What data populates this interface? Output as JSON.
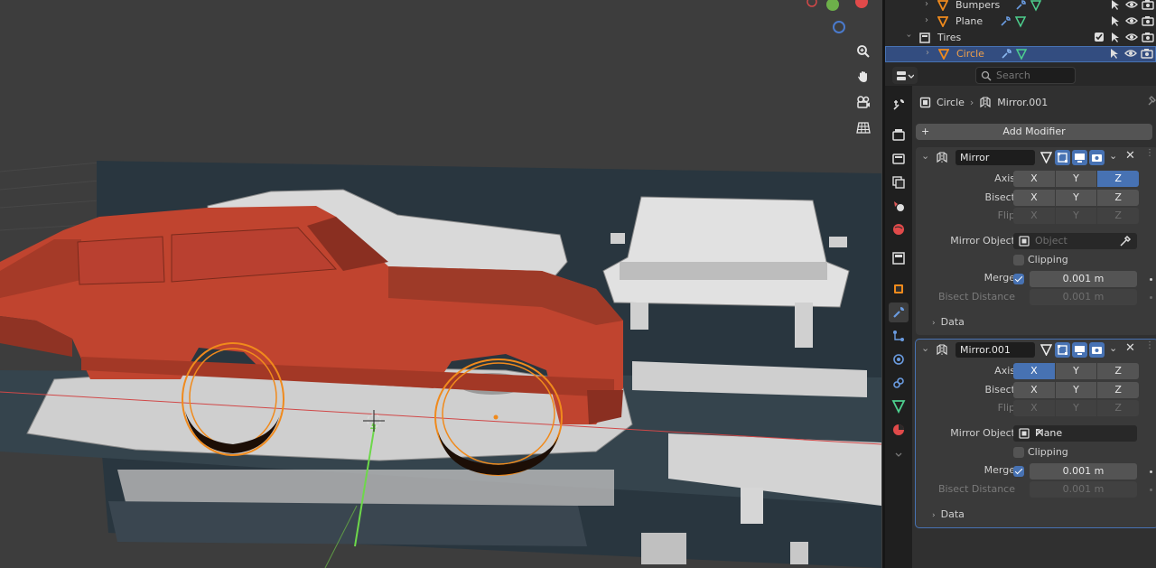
{
  "outliner": {
    "rows": [
      {
        "label": "Bumpers"
      },
      {
        "label": "Plane"
      },
      {
        "label": "Tires"
      },
      {
        "label": "Circle"
      }
    ]
  },
  "properties": {
    "search": {
      "placeholder": "Search"
    },
    "breadcrumb": {
      "object": "Circle",
      "modifier": "Mirror.001"
    },
    "add_modifier": "Add Modifier",
    "modifiers": [
      {
        "name": "Mirror",
        "axis_label": "Axis",
        "axis": [
          "X",
          "Y",
          "Z"
        ],
        "axis_active": "Z",
        "bisect_label": "Bisect",
        "bisect": [
          "X",
          "Y",
          "Z"
        ],
        "flip_label": "Flip",
        "flip": [
          "X",
          "Y",
          "Z"
        ],
        "mirror_object_label": "Mirror Object",
        "mirror_object_value": "",
        "mirror_object_placeholder": "Object",
        "clipping_label": "Clipping",
        "clipping": false,
        "merge_label": "Merge",
        "merge": true,
        "merge_value": "0.001 m",
        "bisect_distance_label": "Bisect Distance",
        "bisect_distance_value": "0.001 m",
        "data_label": "Data"
      },
      {
        "name": "Mirror.001",
        "axis_label": "Axis",
        "axis": [
          "X",
          "Y",
          "Z"
        ],
        "axis_active": "X",
        "bisect_label": "Bisect",
        "bisect": [
          "X",
          "Y",
          "Z"
        ],
        "flip_label": "Flip",
        "flip": [
          "X",
          "Y",
          "Z"
        ],
        "mirror_object_label": "Mirror Object",
        "mirror_object_value": "Plane",
        "mirror_object_placeholder": "",
        "clipping_label": "Clipping",
        "clipping": false,
        "merge_label": "Merge",
        "merge": true,
        "merge_value": "0.001 m",
        "bisect_distance_label": "Bisect Distance",
        "bisect_distance_value": "0.001 m",
        "data_label": "Data"
      }
    ]
  },
  "colors": {
    "accent": "#4772b3",
    "car_body": "#c0442f",
    "selection": "#f08a1c",
    "viewport_bg": "#3d3d3d"
  },
  "icons": {
    "viewport_tools": [
      "zoom-icon",
      "hand-icon",
      "camera-icon",
      "grid-icon"
    ],
    "property_tabs": [
      "tool-icon",
      "render-icon",
      "output-icon",
      "view-layer-icon",
      "scene-icon",
      "world-icon",
      "collection-icon",
      "object-icon",
      "wrench-icon",
      "particles-icon",
      "physics-icon",
      "constraints-icon",
      "data-icon",
      "material-icon"
    ]
  }
}
